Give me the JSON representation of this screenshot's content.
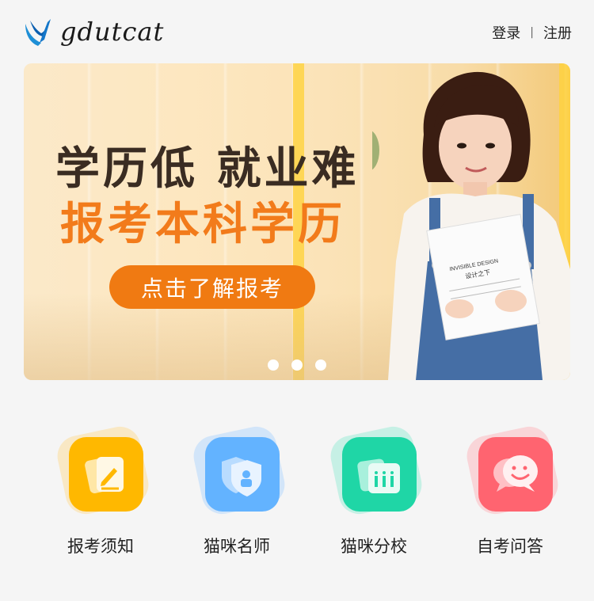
{
  "header": {
    "logo_text": "gdutcat",
    "login_label": "登录",
    "separator": "|",
    "register_label": "注册"
  },
  "banner": {
    "slogan_line1": "学历低 就业难",
    "slogan_line2": "报考本科学历",
    "cta_label": "点击了解报考",
    "book_text_1": "INVISIBLE DESIGN",
    "book_text_2": "设计之下",
    "carousel_dots": 3
  },
  "features": [
    {
      "label": "报考须知",
      "icon": "form-edit-icon",
      "color": "#ffb800",
      "blob": "#ffd98a"
    },
    {
      "label": "猫咪名师",
      "icon": "shield-user-icon",
      "color": "#63b3ff",
      "blob": "#a9d3ff"
    },
    {
      "label": "猫咪分校",
      "icon": "school-building-icon",
      "color": "#1fd6a6",
      "blob": "#8fecd2"
    },
    {
      "label": "自考问答",
      "icon": "chat-bubble-icon",
      "color": "#ff6470",
      "blob": "#ffb0b6"
    }
  ],
  "colors": {
    "accent_orange": "#f07a12",
    "background": "#f5f5f5",
    "text_dark": "#3a2c22"
  }
}
